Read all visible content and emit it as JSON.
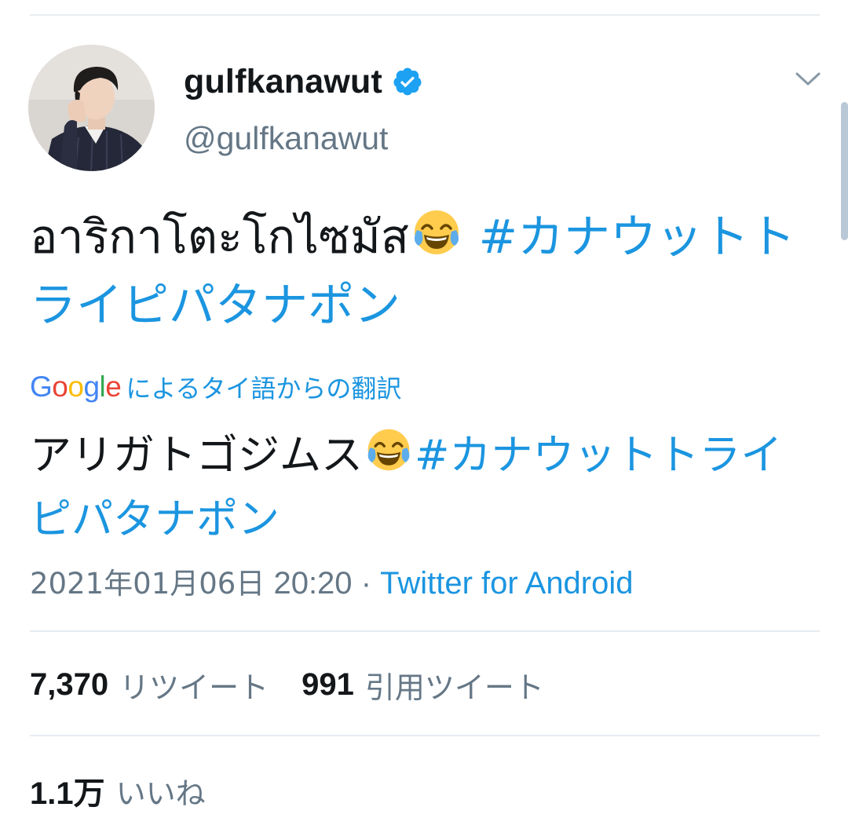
{
  "tweet": {
    "author": {
      "display_name": "gulfkanawut",
      "handle": "@gulfkanawut",
      "verified": true,
      "verified_color": "#1da1f2"
    },
    "text": {
      "main": "อาริกาโตะโกไซมัส",
      "emoji": "face-with-tears-of-joy",
      "hashtag": "#カナウットトライピパタナポン"
    },
    "translation": {
      "provider": "Google",
      "label": "によるタイ語からの翻訳",
      "text": "アリガトゴジムス",
      "hashtag": "#カナウットトライピパタナポン"
    },
    "meta": {
      "date": "2021年01月06日",
      "time": "20:20",
      "separator": "·",
      "source": "Twitter for Android"
    },
    "stats": {
      "retweets_count": "7,370",
      "retweets_label": "リツイート",
      "quotes_count": "991",
      "quotes_label": "引用ツイート",
      "likes_count": "1.1万",
      "likes_label": "いいね"
    }
  },
  "colors": {
    "link": "#1b95e0",
    "text": "#14171a",
    "secondary": "#657786",
    "divider": "#e6ecf0"
  }
}
